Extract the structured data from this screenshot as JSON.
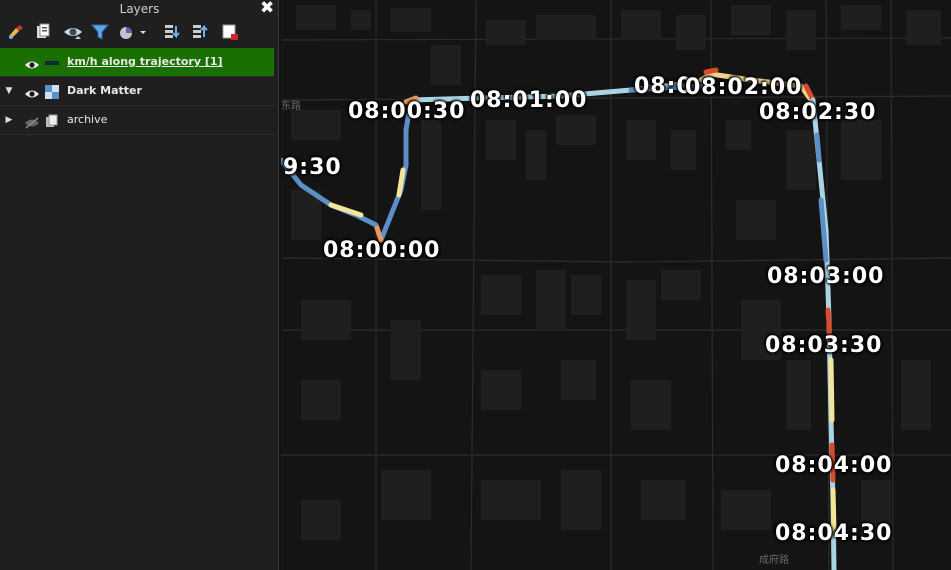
{
  "panel": {
    "title": "Layers",
    "close_glyph": "✖",
    "toolbar": [
      {
        "name": "style-manager-icon",
        "interactable": true
      },
      {
        "name": "add-group-icon",
        "interactable": true
      },
      {
        "name": "visibility-eye-icon",
        "interactable": true
      },
      {
        "name": "filter-icon",
        "interactable": true
      },
      {
        "name": "filter-legend-icon",
        "interactable": true
      },
      {
        "name": "expand-all-icon",
        "interactable": true
      },
      {
        "name": "collapse-all-icon",
        "interactable": true
      },
      {
        "name": "remove-layer-icon",
        "interactable": true
      }
    ],
    "layers": [
      {
        "label": "km/h along trajectory [1]",
        "selected": true,
        "visible": true,
        "arrow": "",
        "icon": "line-symbol-icon"
      },
      {
        "label": "Dark Matter",
        "selected": false,
        "visible": true,
        "arrow": "▼",
        "icon": "raster-tiles-icon"
      },
      {
        "label": "archive",
        "selected": false,
        "visible": false,
        "arrow": "▶",
        "icon": "group-icon"
      }
    ]
  },
  "map": {
    "time_labels": [
      "9:30",
      "08:00:00",
      "08:00:30",
      "08:01:00",
      "08:0",
      "08:02:00",
      "08:02:30",
      "08:03:00",
      "08:03:30",
      "08:04:00",
      "08:04:30"
    ],
    "street_labels": [
      "东路",
      "成府路"
    ]
  },
  "colors": {
    "selection": "#197000",
    "panel_bg": "#1f1f1f",
    "map_bg": "#141414",
    "track_blue": "#5b8fc6",
    "track_yellow": "#f3e59a",
    "track_red": "#d94b2b"
  }
}
